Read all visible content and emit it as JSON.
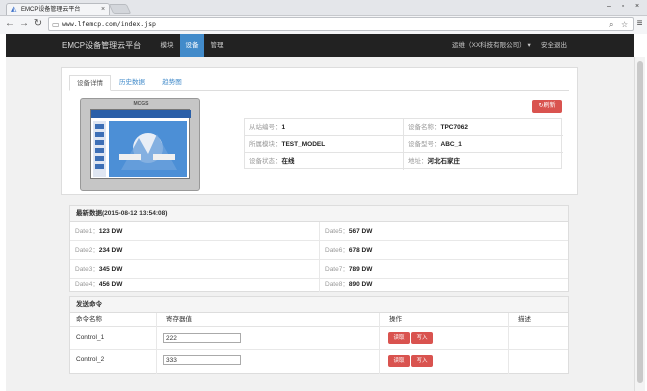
{
  "browser": {
    "tab_title": "EMCP设备管理云平台",
    "url": "www.lfemcp.com/index.jsp"
  },
  "navbar": {
    "brand": "EMCP设备管理云平台",
    "links": [
      "模块",
      "设备",
      "管理"
    ],
    "active_link": "设备",
    "user_menu": "运维（XX科技有限公司）",
    "logout": "安全退出"
  },
  "tabs": [
    "设备详情",
    "历史数据",
    "趋势图"
  ],
  "active_tab": "设备详情",
  "refresh_button": "刷新",
  "device_image": {
    "label": "MCGS"
  },
  "device_info": {
    "slave_no": {
      "label": "从站编号：",
      "value": "1"
    },
    "device_name": {
      "label": "设备名称：",
      "value": "TPC7062"
    },
    "module": {
      "label": "所属模块：",
      "value": "TEST_MODEL"
    },
    "device_model": {
      "label": "设备型号：",
      "value": "ABC_1"
    },
    "status": {
      "label": "设备状态：",
      "value": "在线"
    },
    "address": {
      "label": "地址：",
      "value": "河北石家庄"
    }
  },
  "latest": {
    "title": "最新数据(2015-08-12 13:54:08)",
    "items": [
      {
        "label": "Date1：",
        "value": "123 DW"
      },
      {
        "label": "Date5：",
        "value": "567 DW"
      },
      {
        "label": "Date2：",
        "value": "234 DW"
      },
      {
        "label": "Date6：",
        "value": "678 DW"
      },
      {
        "label": "Date3：",
        "value": "345 DW"
      },
      {
        "label": "Date7：",
        "value": "789 DW"
      },
      {
        "label": "Date4：",
        "value": "456 DW"
      },
      {
        "label": "Date8：",
        "value": "890 DW"
      }
    ]
  },
  "commands": {
    "title": "发送命令",
    "headers": [
      "命令名称",
      "寄存器值",
      "操作",
      "描述"
    ],
    "rows": [
      {
        "name": "Control_1",
        "value": "222",
        "read": "读取",
        "write": "写入"
      },
      {
        "name": "Control_2",
        "value": "333",
        "read": "读取",
        "write": "写入"
      }
    ]
  },
  "colors": {
    "navbar": "#222222",
    "accent": "#428bca",
    "danger": "#d9534f"
  }
}
